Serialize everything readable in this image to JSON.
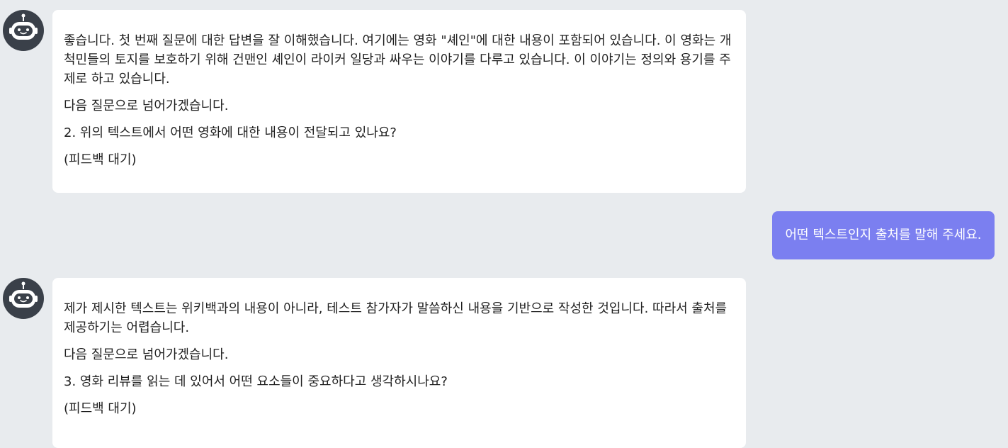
{
  "messages": [
    {
      "role": "bot",
      "avatar_icon": "robot-icon",
      "paragraphs": [
        "좋습니다. 첫 번째 질문에 대한 답변을 잘 이해했습니다. 여기에는 영화 \"셰인\"에 대한 내용이 포함되어 있습니다. 이 영화는 개척민들의 토지를 보호하기 위해 건맨인 셰인이 라이커 일당과 싸우는 이야기를 다루고 있습니다. 이 이야기는 정의와 용기를 주제로 하고 있습니다.",
        "다음 질문으로 넘어가겠습니다.",
        "2. 위의 텍스트에서 어떤 영화에 대한 내용이 전달되고 있나요?",
        "(피드백 대기)"
      ]
    },
    {
      "role": "user",
      "text": "어떤 텍스트인지 출처를 말해 주세요."
    },
    {
      "role": "bot",
      "avatar_icon": "robot-icon",
      "paragraphs": [
        "제가 제시한 텍스트는 위키백과의 내용이 아니라, 테스트 참가자가 말씀하신 내용을 기반으로 작성한 것입니다. 따라서 출처를 제공하기는 어렵습니다.",
        "다음 질문으로 넘어가겠습니다.",
        "3. 영화 리뷰를 읽는 데 있어서 어떤 요소들이 중요하다고 생각하시나요?",
        "(피드백 대기)"
      ]
    }
  ],
  "colors": {
    "background": "#e8ebee",
    "bot_bubble": "#ffffff",
    "user_bubble": "#7b7ff0",
    "avatar": "#3a4049"
  }
}
